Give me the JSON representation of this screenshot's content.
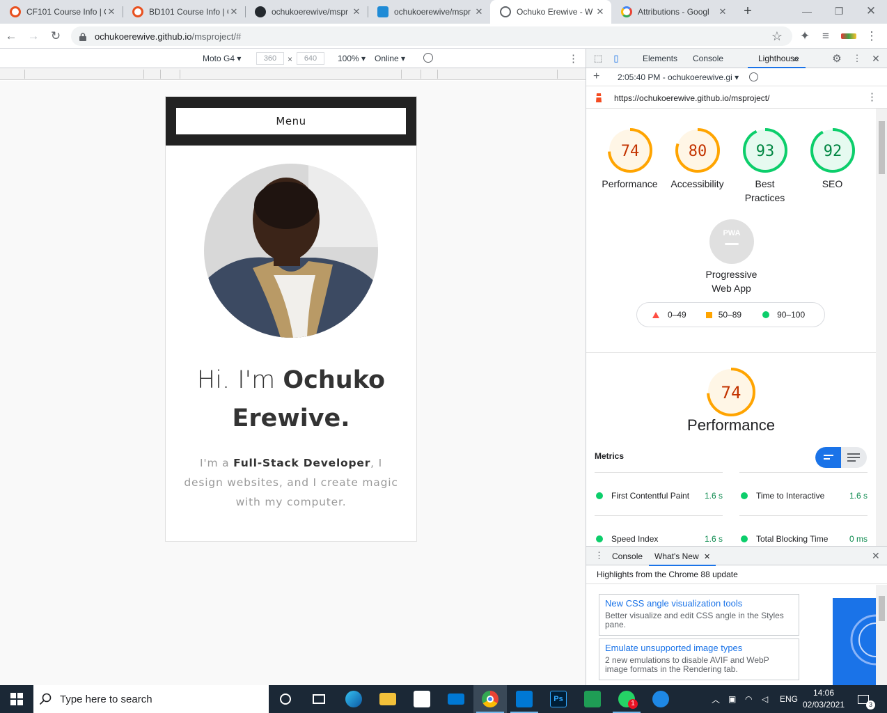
{
  "browser": {
    "tabs": [
      {
        "title": "CF101 Course Info | C",
        "favicon_color": "#e8501f"
      },
      {
        "title": "BD101 Course Info | C",
        "favicon_color": "#e8501f"
      },
      {
        "title": "ochukoerewive/mspr",
        "favicon_color": "#24292e"
      },
      {
        "title": "ochukoerewive/mspr",
        "favicon_color": "#1f8bd6"
      },
      {
        "title": "Ochuko Erewive - W",
        "favicon_color": "#5f6368"
      },
      {
        "title": "Attributions - Googl",
        "favicon_color": "#4285f4"
      }
    ],
    "new_tab_label": "+",
    "url_host": "ochukoerewive.github.io",
    "url_path": "/msproject/#"
  },
  "device_toolbar": {
    "device": "Moto G4",
    "width": "360",
    "height": "640",
    "times": "×",
    "zoom": "100%",
    "network": "Online"
  },
  "site": {
    "menu_label": "Menu",
    "title_light": "Hi. I'm ",
    "title_bold": "Ochuko Erewive.",
    "sub_pre": "I'm a ",
    "sub_bold": "Full-Stack Developer",
    "sub_post": ", I design websites, and I create magic with my computer."
  },
  "devtools": {
    "tabs": [
      "Elements",
      "Console",
      "Lighthouse"
    ],
    "more": "»",
    "report_time": "2:05:40 PM - ochukoerewive.gi",
    "report_url": "https://ochukoerewive.github.io/msproject/",
    "scores": [
      {
        "value": "74",
        "label": "Performance",
        "score": 74,
        "color": "#ffa400",
        "bg": "#fff6e6"
      },
      {
        "value": "80",
        "label": "Accessibility",
        "score": 80,
        "color": "#ffa400",
        "bg": "#fff6e6"
      },
      {
        "value": "93",
        "label": "Best Practices",
        "score": 93,
        "color": "#0cce6b",
        "bg": "#e6faf0"
      },
      {
        "value": "92",
        "label": "SEO",
        "score": 92,
        "color": "#0cce6b",
        "bg": "#e6faf0"
      }
    ],
    "pwa": {
      "badge": "PWA",
      "label": "Progressive Web App"
    },
    "legend": [
      {
        "range": "0–49",
        "color": "#ff4e42"
      },
      {
        "range": "50–89",
        "color": "#ffa400"
      },
      {
        "range": "90–100",
        "color": "#0cce6b"
      }
    ],
    "perf": {
      "value": "74",
      "score": 74,
      "label": "Performance"
    },
    "metrics_heading": "Metrics",
    "metrics": [
      {
        "name": "First Contentful Paint",
        "value": "1.6 s"
      },
      {
        "name": "Time to Interactive",
        "value": "1.6 s"
      },
      {
        "name": "Speed Index",
        "value": "1.6 s"
      },
      {
        "name": "Total Blocking Time",
        "value": "0 ms"
      }
    ],
    "drawer_tabs": [
      "Console",
      "What's New"
    ],
    "drawer_title": "Highlights from the Chrome 88 update",
    "news": [
      {
        "title": "New CSS angle visualization tools",
        "desc": "Better visualize and edit CSS angle in the Styles pane."
      },
      {
        "title": "Emulate unsupported image types",
        "desc": "2 new emulations to disable AVIF and WebP image formats in the Rendering tab."
      }
    ]
  },
  "taskbar": {
    "search_placeholder": "Type here to search",
    "lang": "ENG",
    "time": "14:06",
    "date": "02/03/2021",
    "notifications": "3",
    "whatsapp_badge": "1"
  }
}
